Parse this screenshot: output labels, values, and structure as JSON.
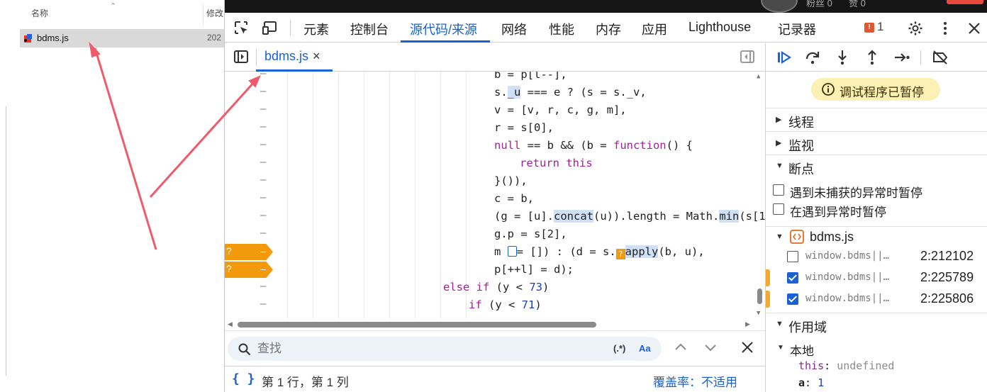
{
  "explorer": {
    "col_name": "名称",
    "col_modified": "修改",
    "file": {
      "name": "bdms.js",
      "date": "202"
    }
  },
  "devtools": {
    "top_strip": {
      "title": "",
      "stat_fans": "粉丝 0",
      "stat_likes": "赞 0"
    },
    "tabs": [
      {
        "label": "元素"
      },
      {
        "label": "控制台"
      },
      {
        "label": "源代码/来源"
      },
      {
        "label": "网络"
      },
      {
        "label": "性能"
      },
      {
        "label": "内存"
      },
      {
        "label": "应用"
      },
      {
        "label": "Lighthouse"
      },
      {
        "label": "记录器"
      }
    ],
    "active_tab": "源代码/来源",
    "issues_count": "1",
    "editor": {
      "file_tab": "bdms.js",
      "close_glyph": "×",
      "gutter_mark": "–",
      "breakpoint_marker": "?",
      "lines": [
        {
          "pre": "b = p[l--],",
          "indent": 380
        },
        {
          "indent": 380
        },
        {
          "text": "v = [v, r, c, g, m],",
          "indent": 380
        },
        {
          "text": "r = s[0],",
          "indent": 380
        },
        {
          "indent": 380
        },
        {
          "indent": 416
        },
        {
          "text": "}()),",
          "indent": 380
        },
        {
          "text": "c = b,",
          "indent": 380
        },
        {
          "indent": 380
        },
        {
          "text": "g.p = s[2],",
          "indent": 380
        },
        {
          "indent": 380
        },
        {
          "indent": 380
        },
        {
          "indent": 308
        },
        {
          "indent": 344
        }
      ],
      "tokens": {
        "l1_a": "s.",
        "l1_u": "_u",
        "l1_b": " === e ? (s = s._v,",
        "l4_null": "null",
        "l4_mid": " == b && (b = ",
        "l4_fn": "function",
        "l4_end": "() {",
        "l5_ret": "return",
        "l5_this": "this",
        "l8_a": "(g = [u].",
        "l8_concat": "concat",
        "l8_b": "(u)).length = Math.",
        "l8_min": "min",
        "l8_c": "(s[1",
        "l10_a": "m ",
        "l10_b": "= []) : (d = s.",
        "l10_apply": "apply",
        "l10_c": "(b, u),",
        "l11": "p[++l] = d);",
        "l12_else": "else",
        "l12_if": "if",
        "l12_a": " (y < ",
        "l12_num": "73",
        "l12_b": ")",
        "l13_if": "if",
        "l13_a": " (y < ",
        "l13_num": "71",
        "l13_b": ")"
      },
      "breakpoint_lines": [
        10,
        11
      ],
      "search_placeholder": "查找",
      "regex_toggle": "(.*)",
      "case_toggle": "Aa",
      "status_position": "第 1 行，第 1 列",
      "coverage": "覆盖率：不适用"
    },
    "debugger": {
      "paused_label": "调试程序已暂停",
      "sections": {
        "threads": "线程",
        "watch": "监视",
        "breakpoints": "断点",
        "scope": "作用域"
      },
      "pause_options": [
        {
          "label": "遇到未捕获的异常时暂停",
          "checked": false
        },
        {
          "label": "在遇到异常时暂停",
          "checked": false
        }
      ],
      "breakpoint_file": "bdms.js",
      "breakpoints": [
        {
          "condition": "window.bdms||…",
          "location": "2:212102",
          "checked": false,
          "marked": false
        },
        {
          "condition": "window.bdms||…",
          "location": "2:225789",
          "checked": true,
          "marked": true
        },
        {
          "condition": "window.bdms||…",
          "location": "2:225806",
          "checked": true,
          "marked": true
        }
      ],
      "scope_local": "本地",
      "vars": [
        {
          "key": "this",
          "value": "undefined"
        },
        {
          "key": "a",
          "value": "1"
        }
      ]
    }
  }
}
